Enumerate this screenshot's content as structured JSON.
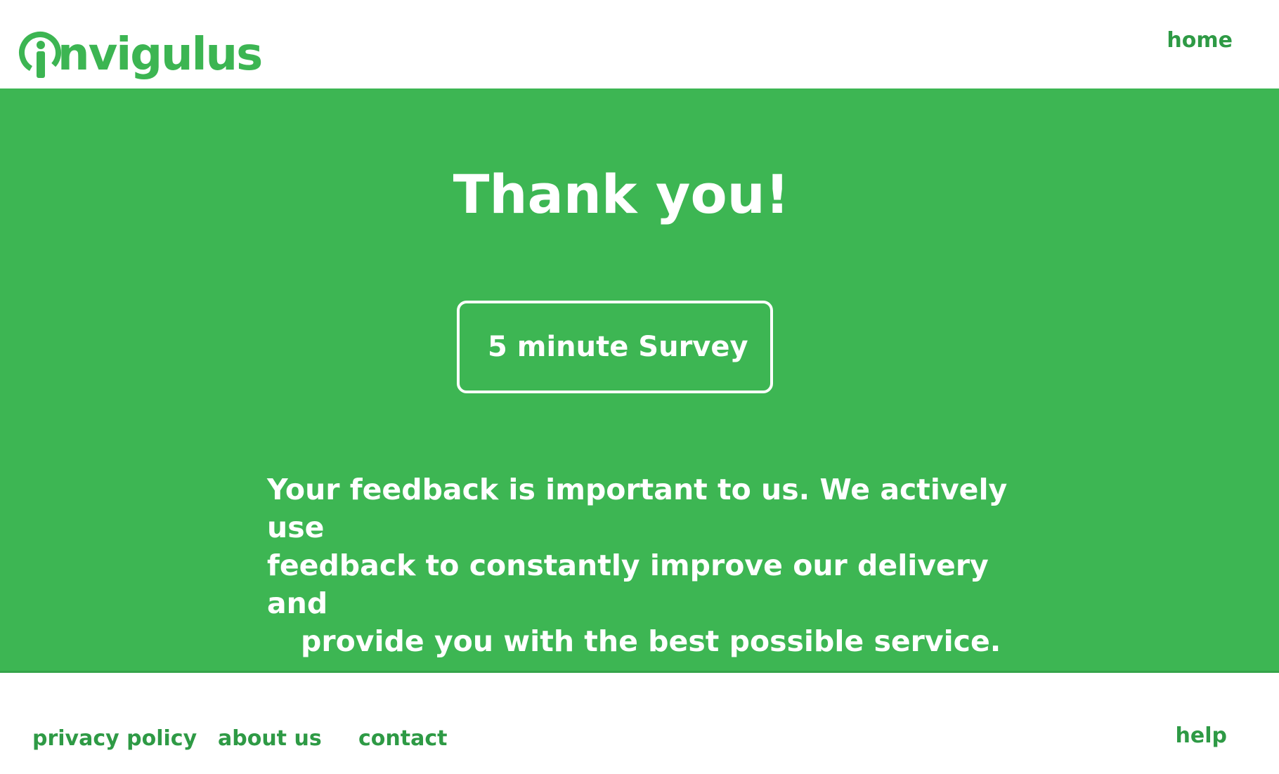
{
  "brand": {
    "logo_text": "nvigulus",
    "logo_letter": "i",
    "color": "#3cb552"
  },
  "header": {
    "nav_home": "home"
  },
  "hero": {
    "background": "#3db653",
    "title": "Thank you!",
    "survey_button": "5 minute Survey",
    "message_lines": [
      "Your feedback is important to us. We actively use",
      "feedback to constantly improve our delivery and",
      "provide you with the best possible service."
    ]
  },
  "footer": {
    "links": [
      "privacy policy",
      "about us",
      "contact"
    ],
    "help": "help"
  }
}
